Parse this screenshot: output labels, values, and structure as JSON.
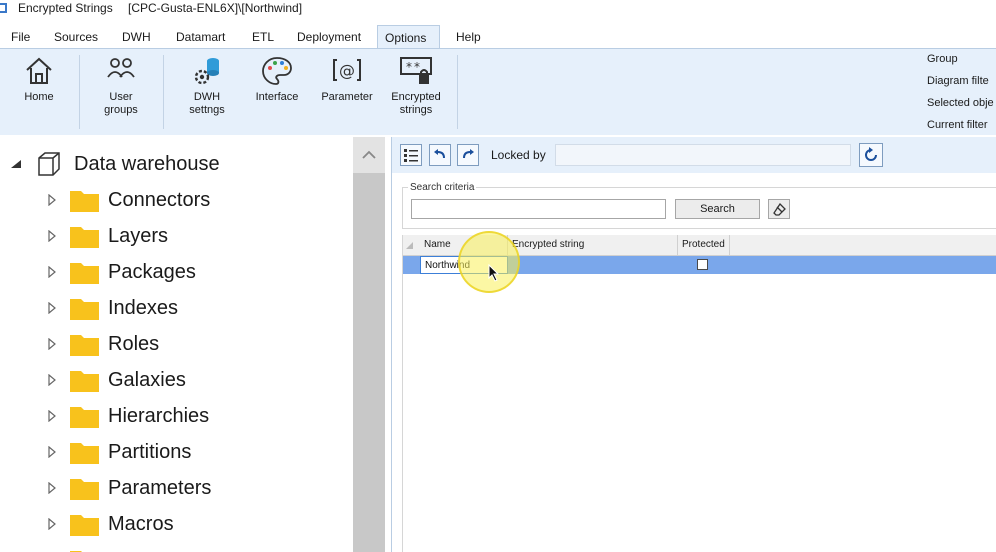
{
  "window": {
    "title": "Encrypted Strings",
    "path": "[CPC-Gusta-ENL6X]\\[Northwind]"
  },
  "menu": {
    "tabs": [
      "File",
      "Sources",
      "DWH",
      "Datamart",
      "ETL",
      "Deployment",
      "Options",
      "Help"
    ],
    "active": "Options"
  },
  "ribbon": {
    "buttons": [
      {
        "label": "Home",
        "icon": "home-icon"
      },
      {
        "label": "User\ngroups",
        "icon": "user-groups-icon"
      },
      {
        "label": "DWH\nsettngs",
        "icon": "dwh-settings-icon"
      },
      {
        "label": "Interface",
        "icon": "palette-icon"
      },
      {
        "label": "Parameter",
        "icon": "parameter-icon"
      },
      {
        "label": "Encrypted\nstrings",
        "icon": "encrypted-strings-icon"
      }
    ],
    "side_items": [
      "Group",
      "Diagram filte",
      "Selected obje",
      "Current filter"
    ]
  },
  "tree": {
    "root": "Data warehouse",
    "children": [
      "Connectors",
      "Layers",
      "Packages",
      "Indexes",
      "Roles",
      "Galaxies",
      "Hierarchies",
      "Partitions",
      "Parameters",
      "Macros"
    ],
    "folder_color": "#f8c21c"
  },
  "toolbar": {
    "locked_by_label": "Locked by",
    "locked_by_value": ""
  },
  "search": {
    "group_title": "Search criteria",
    "input_value": "",
    "button_label": "Search"
  },
  "grid": {
    "columns": [
      "Name",
      "Encrypted string",
      "Protected"
    ],
    "rows": [
      {
        "name": "Northwind",
        "encrypted": "",
        "protected": false
      }
    ],
    "selection_color": "#7aa7eb"
  }
}
